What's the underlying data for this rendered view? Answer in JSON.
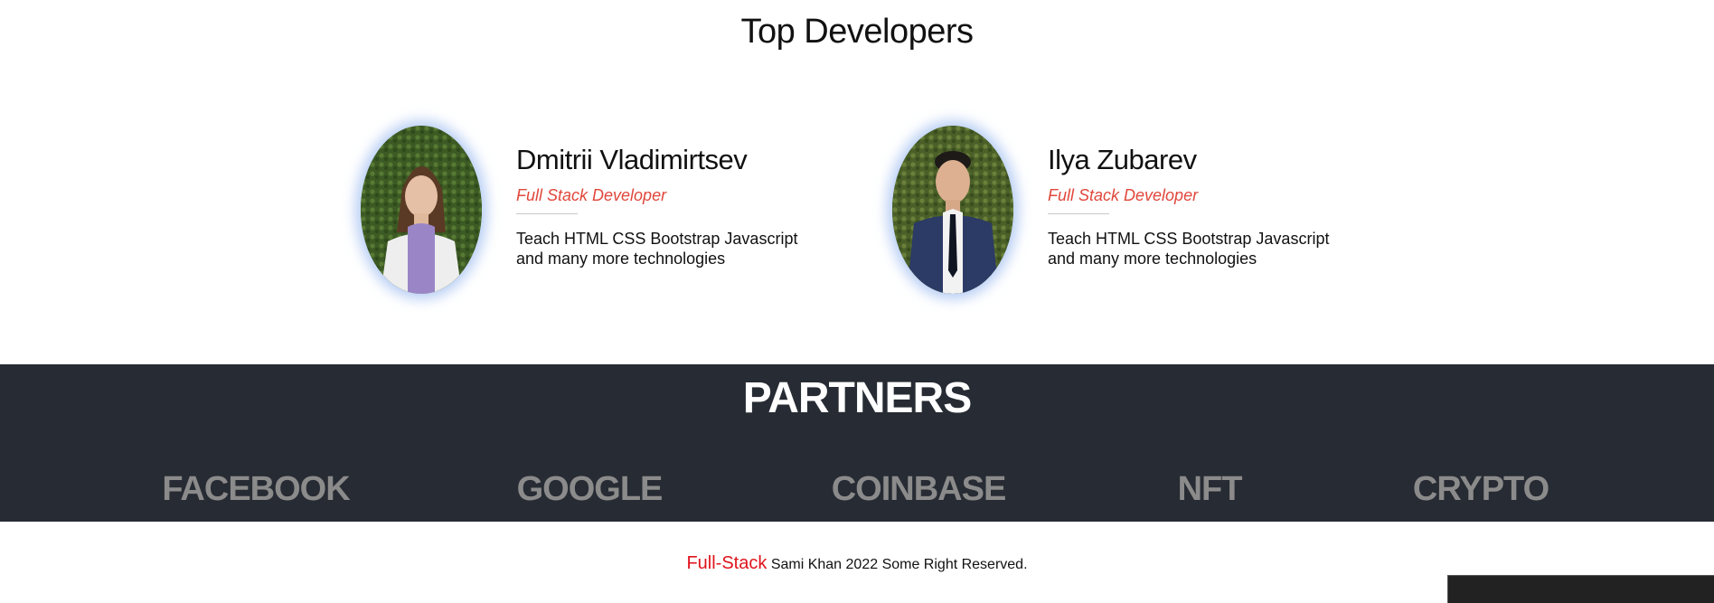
{
  "top_developers": {
    "title": "Top Developers",
    "developers": [
      {
        "name": "Dmitrii Vladimirtsev",
        "role": "Full Stack Developer",
        "description": "Teach HTML CSS Bootstrap Javascript and many more technologies",
        "photo": "portrait-photo-woman"
      },
      {
        "name": "Ilya Zubarev",
        "role": "Full Stack Developer",
        "description": "Teach HTML CSS Bootstrap Javascript and many more technologies",
        "photo": "portrait-photo-man"
      }
    ]
  },
  "partners": {
    "title": "PARTNERS",
    "items": [
      "FACEBOOK",
      "GOOGLE",
      "COINBASE",
      "NFT",
      "CRYPTO"
    ]
  },
  "footer": {
    "brand": "Full-Stack",
    "text": "Sami Khan 2022 Some Right Reserved."
  },
  "colors": {
    "accent": "#e0473b",
    "brand_red": "#e0141c",
    "partners_bg": "#272b33",
    "partner_text": "#8b8b8b"
  }
}
